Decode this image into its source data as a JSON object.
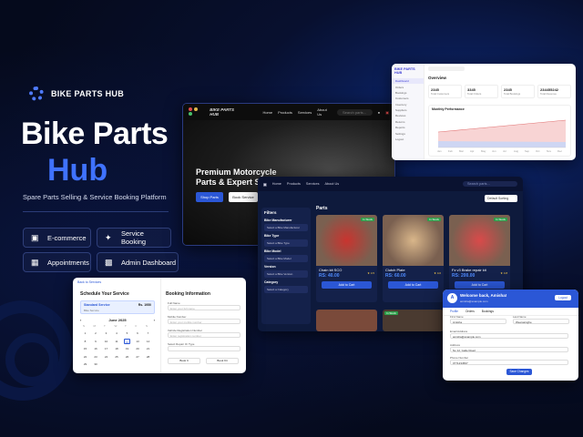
{
  "brand": {
    "name": "BIKE PARTS HUB"
  },
  "headline": {
    "line1": "Bike Parts",
    "line2": "Hub"
  },
  "tagline": "Spare Parts Selling & Service Booking Platform",
  "features": [
    {
      "label": "E-commerce",
      "icon": "cart-icon"
    },
    {
      "label": "Service Booking",
      "icon": "wrench-icon"
    },
    {
      "label": "Appointments",
      "icon": "calendar-icon"
    },
    {
      "label": "Admin Dashboard",
      "icon": "bar-chart-icon"
    }
  ],
  "hero": {
    "logo": "BIKE PARTS HUB",
    "nav": [
      "Home",
      "Products",
      "Services",
      "About Us"
    ],
    "search_placeholder": "Search parts...",
    "heading_l1": "Premium Motorcycle",
    "heading_l2": "Parts & Expert Service",
    "shop_button": "Shop Parts",
    "service_button": "Book Service"
  },
  "admin": {
    "logo": "BIKE PARTS HUB",
    "section": "Overview",
    "stats": [
      {
        "value": "2345",
        "label": "Total Customers"
      },
      {
        "value": "3345",
        "label": "Total Orders"
      },
      {
        "value": "2345",
        "label": "Total Bookings"
      },
      {
        "value": "234455242",
        "label": "Total Revenue"
      }
    ],
    "chart_title": "Monthly Performance",
    "sidebar": [
      "Dashboard",
      "Orders",
      "Bookings",
      "Customers",
      "Inventory",
      "Suppliers",
      "Reviews",
      "Returns",
      "Reports",
      "Settings",
      "Logout"
    ],
    "x_labels": [
      "Jan",
      "Feb",
      "Mar",
      "Apr",
      "May",
      "Jun",
      "Jul",
      "Aug",
      "Sep",
      "Oct",
      "Nov",
      "Dec"
    ]
  },
  "shop": {
    "nav": [
      "Home",
      "Products",
      "Services",
      "About Us"
    ],
    "search_placeholder": "Search parts...",
    "filters_title": "Filters",
    "filters": [
      {
        "label": "Bike Manufacturer",
        "value": "Select a Bike Manufacturer"
      },
      {
        "label": "Bike Type",
        "value": "Select a Bike Type"
      },
      {
        "label": "Bike Model",
        "value": "Select a Bike Model"
      },
      {
        "label": "Version",
        "value": "Select a Bike Version"
      },
      {
        "label": "Category",
        "value": "Select a Category"
      }
    ],
    "heading": "Parts",
    "sort": "Default Sorting",
    "products": [
      {
        "name": "Chain kit SCO",
        "price": "RS: 40.00",
        "badge": "In Stock",
        "rating": "4.5",
        "button": "Add to Cart"
      },
      {
        "name": "Clutch Plate",
        "price": "RS: 60.00",
        "badge": "In Stock",
        "rating": "4.0",
        "button": "Add to Cart"
      },
      {
        "name": "Fz v3 Brake repair kit",
        "price": "RS: 200.00",
        "badge": "In Stock",
        "rating": "4.8",
        "button": "Add to Cart"
      }
    ],
    "row2_badge": "In Stock"
  },
  "booking": {
    "back": "Back to Services",
    "schedule_title": "Schedule Your Service",
    "service_name": "Standard Service",
    "service_sub": "Bike Service",
    "price": "Rs. 1950",
    "month": "June 2025",
    "weekdays": [
      "S",
      "M",
      "T",
      "W",
      "T",
      "F",
      "S"
    ],
    "days": [
      "1",
      "2",
      "3",
      "4",
      "5",
      "6",
      "7",
      "8",
      "9",
      "10",
      "11",
      "12",
      "13",
      "14",
      "15",
      "16",
      "17",
      "18",
      "19",
      "20",
      "21",
      "22",
      "23",
      "24",
      "25",
      "26",
      "27",
      "28",
      "29",
      "30"
    ],
    "selected_day": "12",
    "info_title": "Booking Information",
    "fields": [
      {
        "label": "Full Name",
        "placeholder": "Enter your full name"
      },
      {
        "label": "Mobile Number",
        "placeholder": "Enter your mobile number"
      },
      {
        "label": "Vehicle Registration Number",
        "placeholder": "Enter registration number"
      },
      {
        "label": "Select Repair Or Type",
        "placeholder": ""
      }
    ],
    "buttons": [
      "Book It",
      "Book Kit"
    ]
  },
  "profile": {
    "greeting": "Welcome back, Amisha!",
    "email": "amisha@example.com",
    "logout": "Logout",
    "tabs": [
      "Profile",
      "Orders",
      "Bookings"
    ],
    "fields": [
      {
        "label": "First Name",
        "value": "Amisha"
      },
      {
        "label": "Last Name",
        "value": "Weerasinghe"
      },
      {
        "label": "Email Address",
        "value": "amisha@example.com"
      },
      {
        "label": "Address",
        "value": "No 12, Galle Road"
      },
      {
        "label": "Phone Number",
        "value": "0771234567"
      }
    ],
    "save": "Save Changes"
  },
  "colors": {
    "accent": "#3f72ff",
    "button": "#2b57d6",
    "stock": "#2e9e4a",
    "sale": "#d23a3a"
  }
}
